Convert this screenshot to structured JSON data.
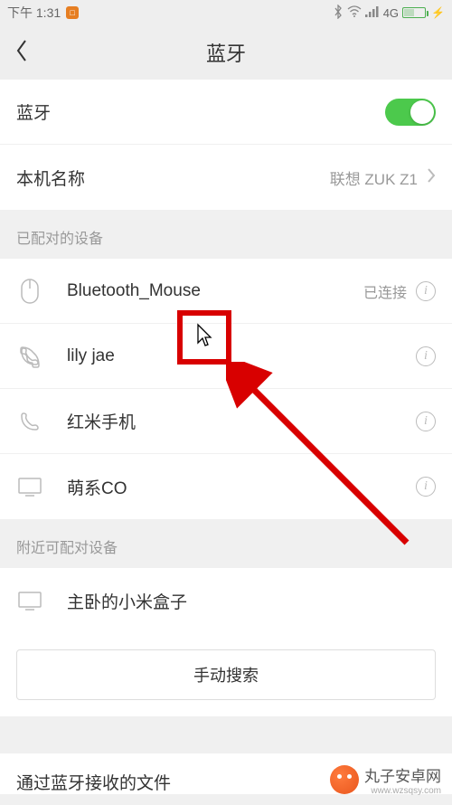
{
  "status": {
    "time": "下午 1:31",
    "network_label": "4G"
  },
  "header": {
    "title": "蓝牙"
  },
  "bluetooth": {
    "label": "蓝牙",
    "on": true
  },
  "device_name": {
    "label": "本机名称",
    "value": "联想 ZUK Z1"
  },
  "paired": {
    "header": "已配对的设备",
    "items": [
      {
        "name": "Bluetooth_Mouse",
        "status": "已连接",
        "icon": "mouse"
      },
      {
        "name": "lily jae",
        "status": "",
        "icon": "phone"
      },
      {
        "name": "红米手机",
        "status": "",
        "icon": "phone"
      },
      {
        "name": "萌系CO",
        "status": "",
        "icon": "monitor"
      }
    ]
  },
  "nearby": {
    "header": "附近可配对设备",
    "items": [
      {
        "name": "主卧的小米盒子",
        "icon": "monitor"
      }
    ]
  },
  "manual_search": "手动搜索",
  "cutoff_text": "通过蓝牙接收的文件",
  "watermark": {
    "text": "丸子安卓网",
    "url": "www.wzsqsy.com"
  }
}
